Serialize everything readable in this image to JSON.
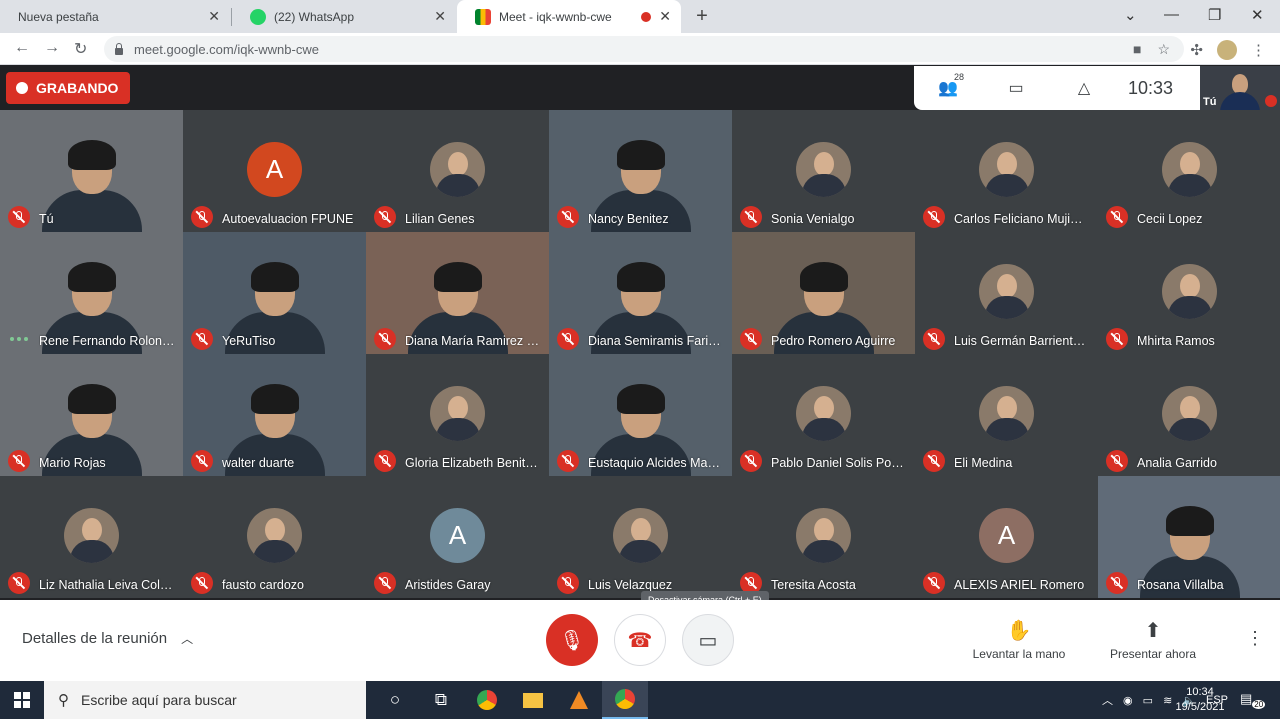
{
  "browser": {
    "tabs": [
      {
        "title": "Nueva pestaña",
        "active": false
      },
      {
        "title": "(22) WhatsApp",
        "active": false
      },
      {
        "title": "Meet - iqk-wwnb-cwe",
        "active": true
      }
    ],
    "url": "meet.google.com/iqk-wwnb-cwe"
  },
  "meet": {
    "recording_label": "GRABANDO",
    "participant_count": "28",
    "time": "10:33",
    "self_label": "Tú",
    "participants": [
      {
        "name": "Tú",
        "type": "camera"
      },
      {
        "name": "Autoevaluacion FPUNE",
        "type": "letter",
        "letter": "A",
        "color": "#d2481f"
      },
      {
        "name": "Lilian Genes",
        "type": "photo"
      },
      {
        "name": "Nancy Benitez",
        "type": "camera"
      },
      {
        "name": "Sonia Venialgo",
        "type": "photo"
      },
      {
        "name": "Carlos Feliciano Muji…",
        "type": "photo"
      },
      {
        "name": "Cecii Lopez",
        "type": "photo"
      },
      {
        "name": "Rene Fernando Rolon…",
        "type": "camera",
        "talking": true
      },
      {
        "name": "YeRuTiso",
        "type": "camera"
      },
      {
        "name": "Diana María Ramirez …",
        "type": "camera"
      },
      {
        "name": "Diana Semiramis Fari…",
        "type": "camera"
      },
      {
        "name": "Pedro Romero Aguirre",
        "type": "camera"
      },
      {
        "name": "Luis Germán Barrient…",
        "type": "photo"
      },
      {
        "name": "Mhirta Ramos",
        "type": "photo"
      },
      {
        "name": "Mario Rojas",
        "type": "camera"
      },
      {
        "name": "walter duarte",
        "type": "camera"
      },
      {
        "name": "Gloria Elizabeth Benit…",
        "type": "photo"
      },
      {
        "name": "Eustaquio Alcides Ma…",
        "type": "camera"
      },
      {
        "name": "Pablo Daniel Solis Po…",
        "type": "photo"
      },
      {
        "name": "Eli Medina",
        "type": "photo"
      },
      {
        "name": "Analia Garrido",
        "type": "photo"
      },
      {
        "name": "Liz Nathalia Leiva Col…",
        "type": "photo"
      },
      {
        "name": "fausto cardozo",
        "type": "photo"
      },
      {
        "name": "Aristides Garay",
        "type": "letter",
        "letter": "A",
        "color": "#6f8a9a"
      },
      {
        "name": "Luis Velazquez",
        "type": "photo"
      },
      {
        "name": "Teresita Acosta",
        "type": "photo"
      },
      {
        "name": "ALEXIS ARIEL Romero",
        "type": "letter",
        "letter": "A",
        "color": "#8d6e63"
      },
      {
        "name": "Rosana Villalba",
        "type": "camera"
      }
    ],
    "details_label": "Detalles de la reunión",
    "tooltip": "Desactivar cámara (Ctrl + E)",
    "raise_hand_label": "Levantar la mano",
    "present_label": "Presentar ahora"
  },
  "taskbar": {
    "search_placeholder": "Escribe aquí para buscar",
    "lang": "ESP",
    "clock_time": "10:34",
    "clock_date": "19/5/2021",
    "notifications": "20"
  }
}
